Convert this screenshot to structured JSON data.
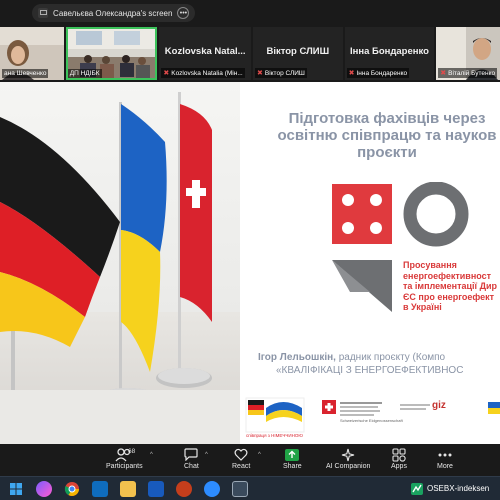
{
  "share_bar": {
    "text": "Савельєва Олександра's screen"
  },
  "participants": [
    {
      "label": "ана Шевченко",
      "big_name": "",
      "muted": false
    },
    {
      "label": "ДП НДІБК",
      "big_name": "",
      "muted": false
    },
    {
      "label": "Kozlovska Natalia (Мін...",
      "big_name": "Kozlovska  Natal...",
      "muted": true
    },
    {
      "label": "Віктор СЛИШ",
      "big_name": "Віктор СЛИШ",
      "muted": true
    },
    {
      "label": "Інна Бондаренко",
      "big_name": "Інна Бондаренко",
      "muted": true
    },
    {
      "label": "Віталій Бутенко",
      "big_name": "",
      "muted": true
    }
  ],
  "slide": {
    "title_line1": "Підготовка фахівців через",
    "title_line2": "освітню співпрацю та науков",
    "title_line3": "проєкти",
    "logo_caption": [
      "Просування",
      "енергоефективност",
      "та імплементації Дир",
      "ЄС про енергоефект",
      "в Україні"
    ],
    "speaker_name": "Ігор Лельошкін,",
    "speaker_role": " радник проєкту (Компо",
    "project_name": "«КВАЛІФІКАЦІ З ЕНЕРГОЕФЕКТИВНОС",
    "footer_left": "співпраця з НІМЕЧЧИНОЮ",
    "footer_mid": "Schweizerische Eidgenossenschaft",
    "footer_giz": "giz"
  },
  "toolbar": {
    "participants_count": "68",
    "participants": "Participants",
    "chat": "Chat",
    "react": "React",
    "share": "Share",
    "ai": "AI Companion",
    "apps": "Apps",
    "more": "More"
  },
  "taskbar": {
    "running_app": "OSEBX-indeksen"
  },
  "colors": {
    "share_green": "#20a346",
    "active_border": "#3cc35b",
    "slide_title": "#8a94a6",
    "logo_red": "#e03a3e",
    "logo_gray": "#6d6f72"
  }
}
